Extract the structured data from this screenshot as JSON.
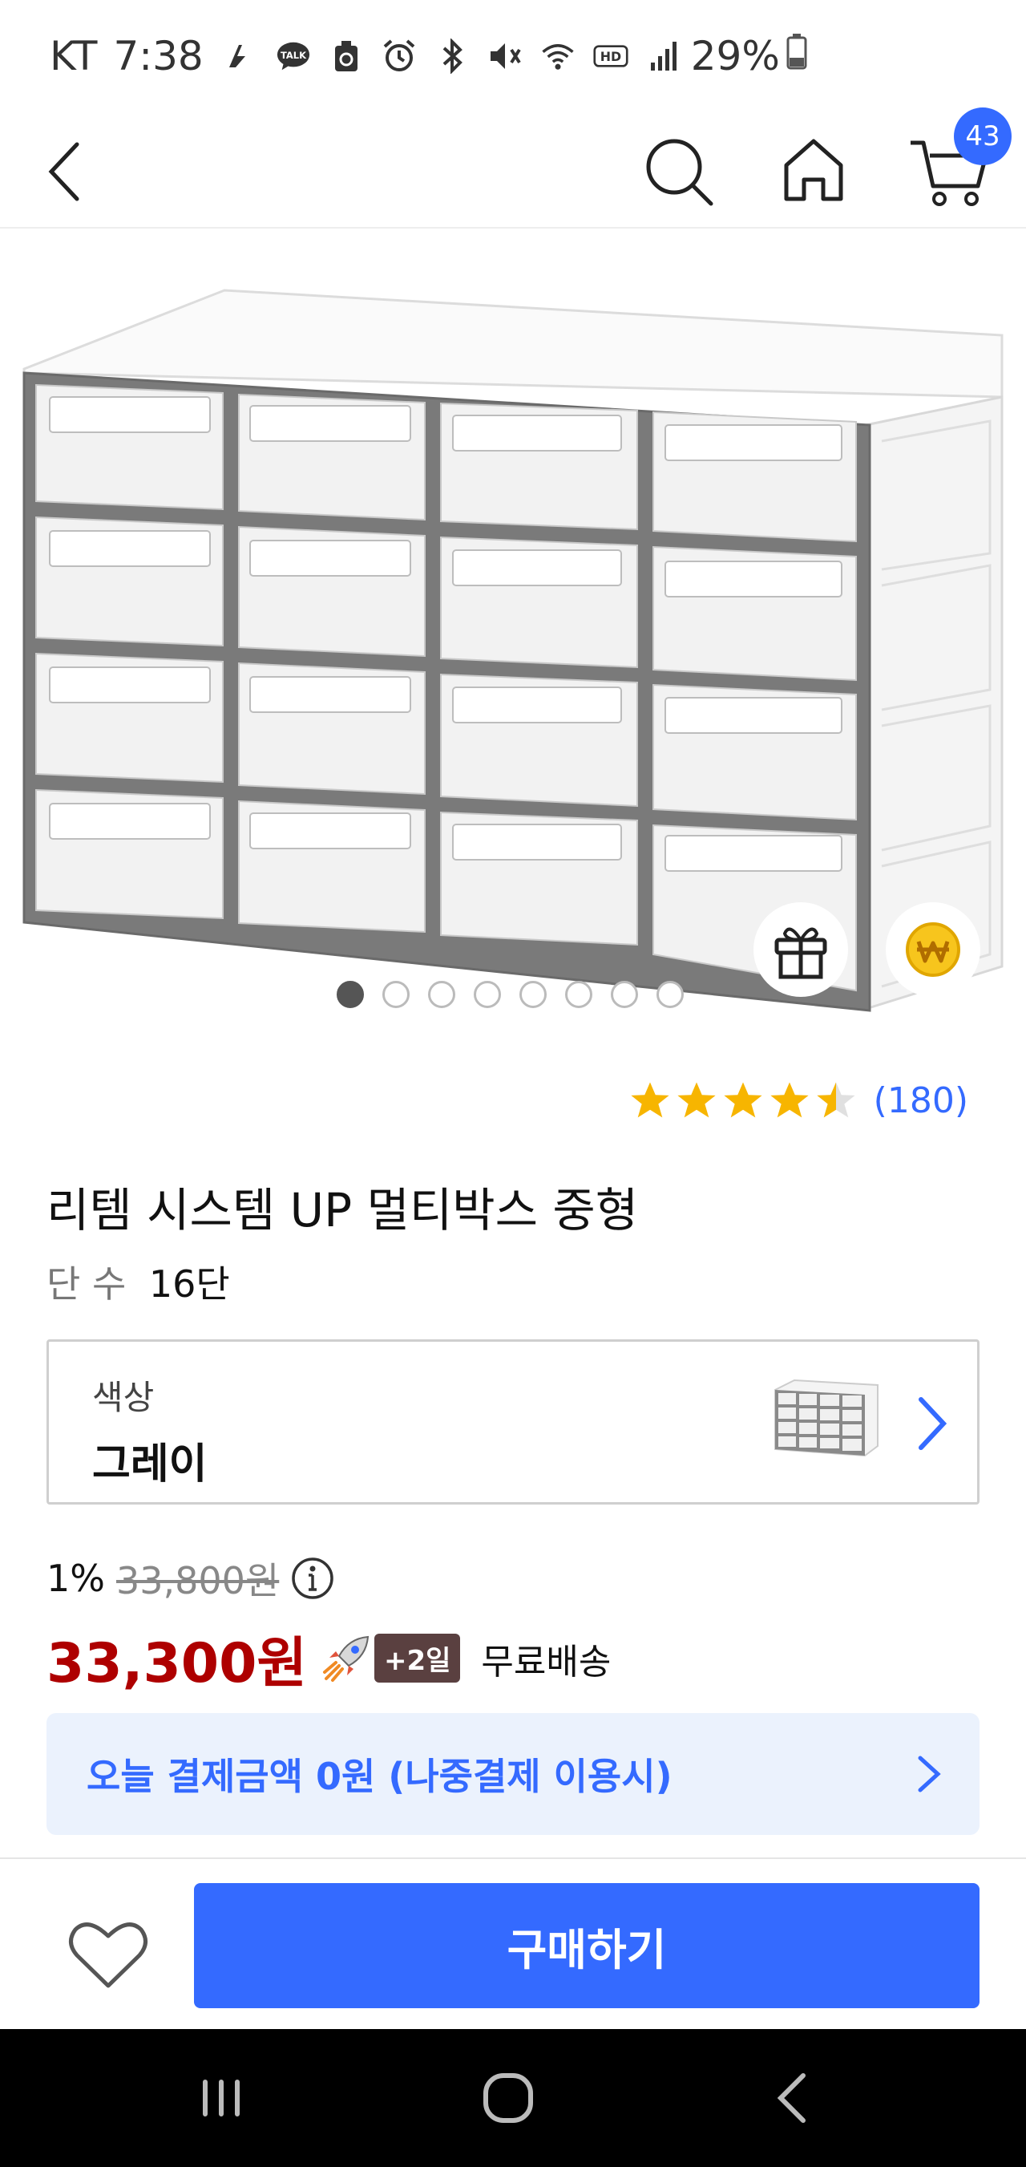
{
  "status_bar": {
    "carrier": "KT",
    "time": "7:38",
    "battery": "29%",
    "icons": [
      "rocket-status-icon",
      "talk-icon",
      "recycle-icon",
      "alarm-icon",
      "bluetooth-icon",
      "mute-icon",
      "wifi-icon",
      "hd-icon",
      "signal-icon",
      "battery-icon"
    ]
  },
  "header": {
    "cart_count": "43",
    "icons": [
      "back-icon",
      "search-icon",
      "home-icon",
      "cart-icon"
    ]
  },
  "gallery": {
    "image_count": 8,
    "active_index": 0
  },
  "rating": {
    "stars": 4.5,
    "review_count": "(180)"
  },
  "product": {
    "title": "리템 시스템 UP 멀티박스 중형",
    "spec_label": "단 수",
    "spec_value": "16단"
  },
  "option": {
    "label": "색상",
    "value": "그레이"
  },
  "price": {
    "discount": "1%",
    "original": "33,800원",
    "sale": "33,300원",
    "delivery_badge": "+2일",
    "shipping": "무료배송"
  },
  "paylater": {
    "text": "오늘 결제금액 0원 (나중결제 이용시)"
  },
  "bottom": {
    "buy_label": "구매하기"
  },
  "colors": {
    "accent": "#346aff",
    "sale": "#ae0000",
    "banner_bg": "#ebf2fd"
  }
}
